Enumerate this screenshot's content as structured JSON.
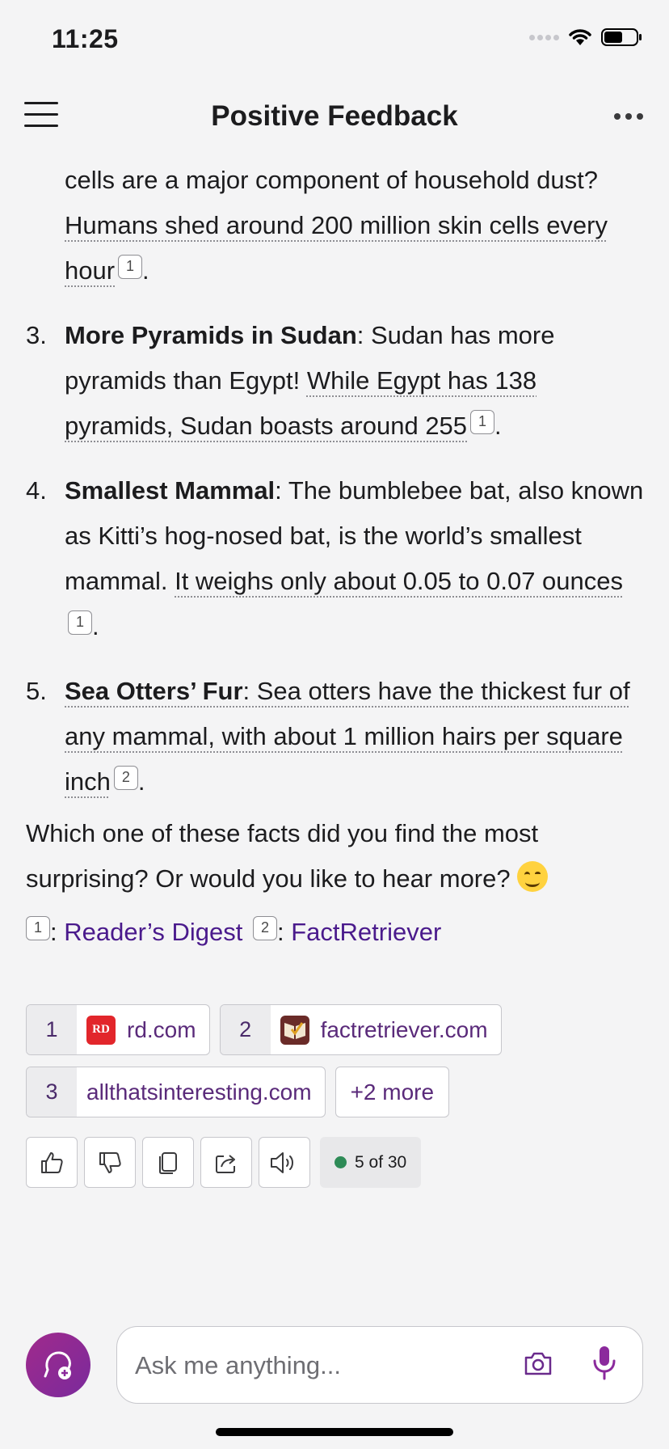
{
  "status_bar": {
    "time": "11:25"
  },
  "header": {
    "title": "Positive Feedback"
  },
  "content": {
    "intro_plain": "cells are a major component of household dust?",
    "intro_underlined": "Humans shed around 200 million skin cells every hour",
    "intro_cite": "1",
    "items": [
      {
        "num": "3.",
        "heading": "More Pyramids in Sudan",
        "text": ": Sudan has more pyramids than Egypt! ",
        "underlined": "While Egypt has 138 pyramids, Sudan boasts around 255",
        "cite": "1"
      },
      {
        "num": "4.",
        "heading": "Smallest Mammal",
        "text": ": The bumblebee bat, also known as Kitti’s hog-nosed bat, is the world’s smallest mammal. ",
        "underlined": "It weighs only about 0.05 to 0.07 ounces",
        "cite": "1"
      },
      {
        "num": "5.",
        "heading": "Sea Otters’ Fur",
        "text": "",
        "underlined": ": Sea otters have the thickest fur of any mammal, with about 1 million hairs per square inch",
        "cite": "2"
      }
    ],
    "closing": "Which one of these facts did you find the most surprising? Or would you like to hear more?",
    "sources": [
      {
        "cite": "1",
        "label": "Reader’s Digest"
      },
      {
        "cite": "2",
        "label": "FactRetriever"
      }
    ]
  },
  "references": [
    {
      "num": "1",
      "domain": "rd.com",
      "icon": "rd-favicon"
    },
    {
      "num": "2",
      "domain": "factretriever.com",
      "icon": "factretriever-favicon"
    },
    {
      "num": "3",
      "domain": "allthatsinteresting.com",
      "icon": ""
    }
  ],
  "references_more": "+2 more",
  "actions": {
    "counter": "5 of 30",
    "counter_color": "#2e8b57"
  },
  "composer": {
    "placeholder": "Ask me anything..."
  },
  "colors": {
    "accent": "#8b2a9c",
    "link": "#4a1a8c",
    "background": "#f4f4f5"
  }
}
